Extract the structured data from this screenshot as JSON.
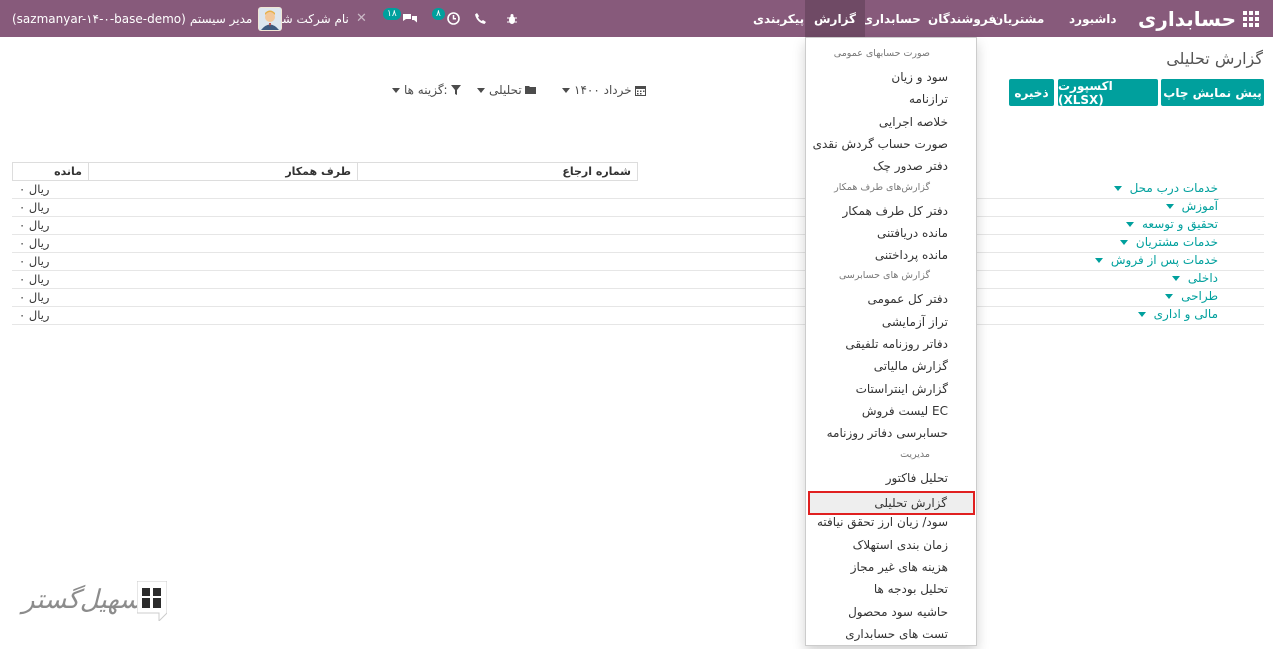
{
  "navbar": {
    "app_title": "حسابداری",
    "menu": [
      "داشبورد",
      "مشتریان",
      "فروشندگان",
      "حسابداری",
      "گزارش",
      "پیکربندی"
    ],
    "active_menu": "گزارش",
    "messages_count": "۱۸",
    "activities_count": "۸",
    "company_name": "نام شرکت شما",
    "user_name": "مدیر سیستم",
    "database": "(sazmanyar-۱۴-۰-base-demo)"
  },
  "control_panel": {
    "title": "گزارش تحلیلی",
    "buttons": {
      "print_preview": "پیش نمایش چاپ",
      "export_xlsx": "اکسپورت (XLSX)",
      "save": "ذخیره"
    },
    "filters": {
      "date": "خرداد ۱۴۰۰",
      "analytic": "تحلیلی",
      "options": "گزینه ها:"
    }
  },
  "report": {
    "columns": {
      "reference": "شماره ارجاع",
      "partner": "طرف همکار",
      "balance": "مانده"
    },
    "rows": [
      {
        "account": "خدمات درب محل",
        "balance": "۰ ریال"
      },
      {
        "account": "آموزش",
        "balance": "۰ ریال"
      },
      {
        "account": "تحقیق و توسعه",
        "balance": "۰ ریال"
      },
      {
        "account": "خدمات مشتریان",
        "balance": "۰ ریال"
      },
      {
        "account": "خدمات پس از فروش",
        "balance": "۰ ریال"
      },
      {
        "account": "داخلی",
        "balance": "۰ ریال"
      },
      {
        "account": "طراحی",
        "balance": "۰ ریال"
      },
      {
        "account": "مالی و اداری",
        "balance": "۰ ریال"
      }
    ]
  },
  "dropdown": {
    "items": [
      {
        "type": "header",
        "label": "صورت حسابهای عمومی"
      },
      {
        "type": "item",
        "label": "سود و زیان"
      },
      {
        "type": "item",
        "label": "ترازنامه"
      },
      {
        "type": "item",
        "label": "خلاصه اجرایی"
      },
      {
        "type": "item",
        "label": "صورت حساب گردش نقدی"
      },
      {
        "type": "item",
        "label": "دفتر صدور چک"
      },
      {
        "type": "header",
        "label": "گزارش‌های طرف همکار"
      },
      {
        "type": "item",
        "label": "دفتر کل طرف همکار"
      },
      {
        "type": "item",
        "label": "مانده دریافتنی"
      },
      {
        "type": "item",
        "label": "مانده پرداختنی"
      },
      {
        "type": "header",
        "label": "گزارش های حسابرسی"
      },
      {
        "type": "item",
        "label": "دفتر کل عمومی"
      },
      {
        "type": "item",
        "label": "تراز آزمایشی"
      },
      {
        "type": "item",
        "label": "دفاتر روزنامه تلفیقی"
      },
      {
        "type": "item",
        "label": "گزارش مالیاتی"
      },
      {
        "type": "item",
        "label": "گزارش اینتراستات"
      },
      {
        "type": "item",
        "label": "لیست فروش EC"
      },
      {
        "type": "item",
        "label": "حسابرسی دفاتر روزنامه"
      },
      {
        "type": "header",
        "label": "مدیریت"
      },
      {
        "type": "item",
        "label": "تحلیل فاکتور"
      },
      {
        "type": "active",
        "label": "گزارش تحلیلی"
      },
      {
        "type": "item",
        "label": "سود/ زیان ارز تحقق نیافته"
      },
      {
        "type": "item",
        "label": "زمان بندی استهلاک"
      },
      {
        "type": "item",
        "label": "هزینه های غیر مجاز"
      },
      {
        "type": "item",
        "label": "تحلیل بودجه ها"
      },
      {
        "type": "item",
        "label": "حاشیه سود محصول"
      },
      {
        "type": "item",
        "label": "تست های حسابداری"
      }
    ]
  },
  "watermark": {
    "text": "تسهیل‌گستر"
  },
  "colors": {
    "navbar": "#875a7b",
    "primary": "#00a09d",
    "highlight_border": "#e02020"
  }
}
